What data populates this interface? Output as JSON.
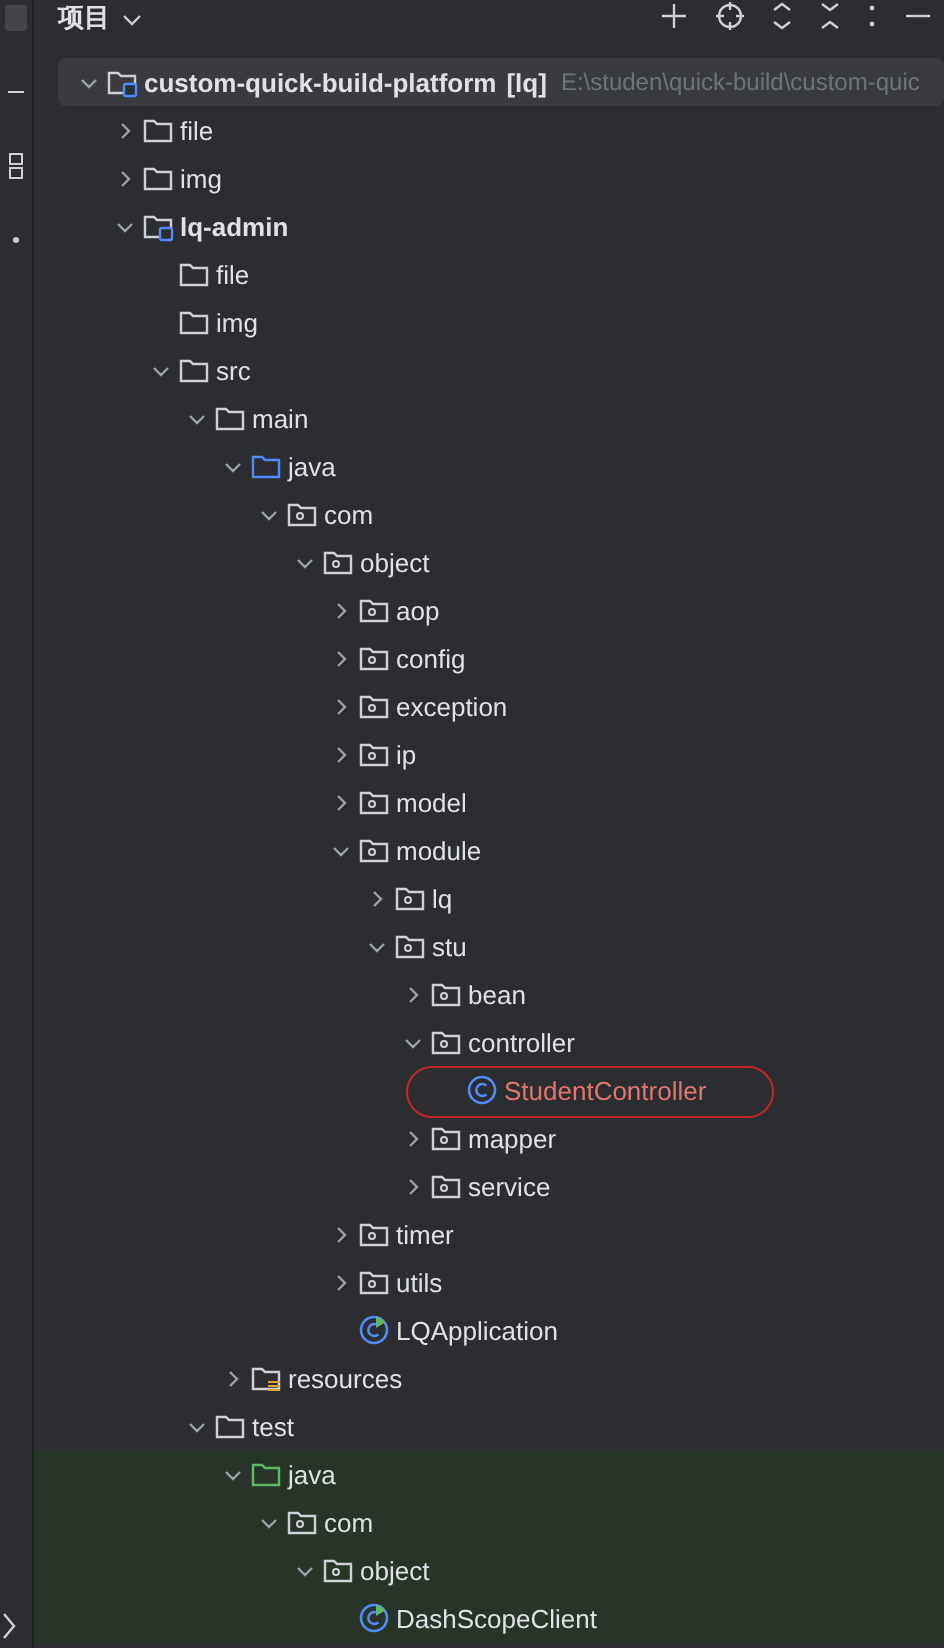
{
  "header": {
    "title": "项目"
  },
  "tree": [
    {
      "name": "custom-quick-build-platform",
      "tag": "[lq]",
      "path": "E:\\studen\\quick-build\\custom-quic",
      "kind": "module",
      "expanded": true,
      "selected": true,
      "circled": false,
      "children": [
        {
          "name": "file",
          "kind": "folder",
          "expanded": false,
          "selected": false,
          "circled": false
        },
        {
          "name": "img",
          "kind": "folder",
          "expanded": false,
          "selected": false,
          "circled": false
        },
        {
          "name": "lq-admin",
          "kind": "module",
          "expanded": true,
          "selected": false,
          "circled": false,
          "children": [
            {
              "name": "file",
              "kind": "folder",
              "selected": false,
              "circled": false
            },
            {
              "name": "img",
              "kind": "folder",
              "selected": false,
              "circled": false
            },
            {
              "name": "src",
              "kind": "folder",
              "expanded": true,
              "selected": false,
              "circled": false,
              "children": [
                {
                  "name": "main",
                  "kind": "folder",
                  "expanded": true,
                  "selected": false,
                  "circled": false,
                  "children": [
                    {
                      "name": "java",
                      "kind": "source",
                      "expanded": true,
                      "selected": false,
                      "circled": false,
                      "children": [
                        {
                          "name": "com",
                          "kind": "package",
                          "expanded": true,
                          "selected": false,
                          "circled": false,
                          "children": [
                            {
                              "name": "object",
                              "kind": "package",
                              "expanded": true,
                              "selected": false,
                              "circled": false,
                              "children": [
                                {
                                  "name": "aop",
                                  "kind": "package",
                                  "expanded": false,
                                  "selected": false,
                                  "circled": false
                                },
                                {
                                  "name": "config",
                                  "kind": "package",
                                  "expanded": false,
                                  "selected": false,
                                  "circled": false
                                },
                                {
                                  "name": "exception",
                                  "kind": "package",
                                  "expanded": false,
                                  "selected": false,
                                  "circled": false
                                },
                                {
                                  "name": "ip",
                                  "kind": "package",
                                  "expanded": false,
                                  "selected": false,
                                  "circled": false
                                },
                                {
                                  "name": "model",
                                  "kind": "package",
                                  "expanded": false,
                                  "selected": false,
                                  "circled": false
                                },
                                {
                                  "name": "module",
                                  "kind": "package",
                                  "expanded": true,
                                  "selected": false,
                                  "circled": false,
                                  "children": [
                                    {
                                      "name": "lq",
                                      "kind": "package",
                                      "expanded": false,
                                      "selected": false,
                                      "circled": false
                                    },
                                    {
                                      "name": "stu",
                                      "kind": "package",
                                      "expanded": true,
                                      "selected": false,
                                      "circled": false,
                                      "children": [
                                        {
                                          "name": "bean",
                                          "kind": "package",
                                          "expanded": false,
                                          "selected": false,
                                          "circled": false
                                        },
                                        {
                                          "name": "controller",
                                          "kind": "package",
                                          "expanded": true,
                                          "selected": false,
                                          "circled": false,
                                          "children": [
                                            {
                                              "name": "StudentController",
                                              "kind": "class",
                                              "selected": false,
                                              "circled": true
                                            }
                                          ]
                                        },
                                        {
                                          "name": "mapper",
                                          "kind": "package",
                                          "expanded": false,
                                          "selected": false,
                                          "circled": false
                                        },
                                        {
                                          "name": "service",
                                          "kind": "package",
                                          "expanded": false,
                                          "selected": false,
                                          "circled": false
                                        }
                                      ]
                                    }
                                  ]
                                },
                                {
                                  "name": "timer",
                                  "kind": "package",
                                  "expanded": false,
                                  "selected": false,
                                  "circled": false
                                },
                                {
                                  "name": "utils",
                                  "kind": "package",
                                  "expanded": false,
                                  "selected": false,
                                  "circled": false
                                },
                                {
                                  "name": "LQApplication",
                                  "kind": "app-class",
                                  "selected": false,
                                  "circled": false
                                }
                              ]
                            }
                          ]
                        }
                      ]
                    },
                    {
                      "name": "resources",
                      "kind": "resources",
                      "expanded": false,
                      "selected": false,
                      "circled": false
                    }
                  ]
                },
                {
                  "name": "test",
                  "kind": "folder",
                  "expanded": true,
                  "selected": false,
                  "circled": false,
                  "children": [
                    {
                      "name": "java",
                      "kind": "test-source",
                      "expanded": true,
                      "selected": false,
                      "circled": false,
                      "children": [
                        {
                          "name": "com",
                          "kind": "package",
                          "expanded": true,
                          "selected": false,
                          "circled": false,
                          "children": [
                            {
                              "name": "object",
                              "kind": "package",
                              "expanded": true,
                              "selected": false,
                              "circled": false,
                              "children": [
                                {
                                  "name": "DashScopeClient",
                                  "kind": "app-class",
                                  "selected": false,
                                  "circled": false
                                }
                              ]
                            }
                          ]
                        }
                      ]
                    }
                  ]
                }
              ]
            }
          ]
        }
      ]
    }
  ]
}
